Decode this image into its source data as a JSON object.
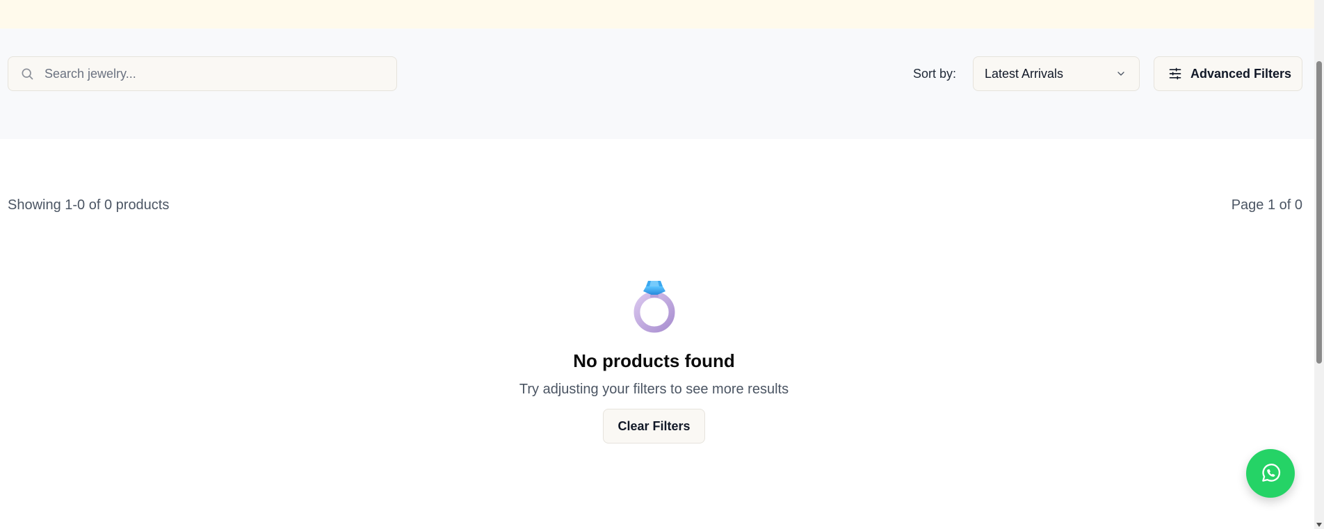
{
  "search": {
    "placeholder": "Search jewelry...",
    "icon": "search-icon"
  },
  "sort": {
    "label": "Sort by:",
    "selected": "Latest Arrivals",
    "icon": "chevron-down-icon"
  },
  "advanced_filters": {
    "label": "Advanced Filters",
    "icon": "sliders-icon"
  },
  "results": {
    "count_text": "Showing 1-0 of 0 products",
    "page_text": "Page 1 of 0"
  },
  "empty_state": {
    "icon": "ring-icon",
    "title": "No products found",
    "subtitle": "Try adjusting your filters to see more results",
    "clear_label": "Clear Filters"
  },
  "fab": {
    "icon": "whatsapp-icon",
    "color": "#25d366"
  },
  "colors": {
    "top_strip": "#fffaec",
    "filter_bar": "#f8f9fb"
  }
}
